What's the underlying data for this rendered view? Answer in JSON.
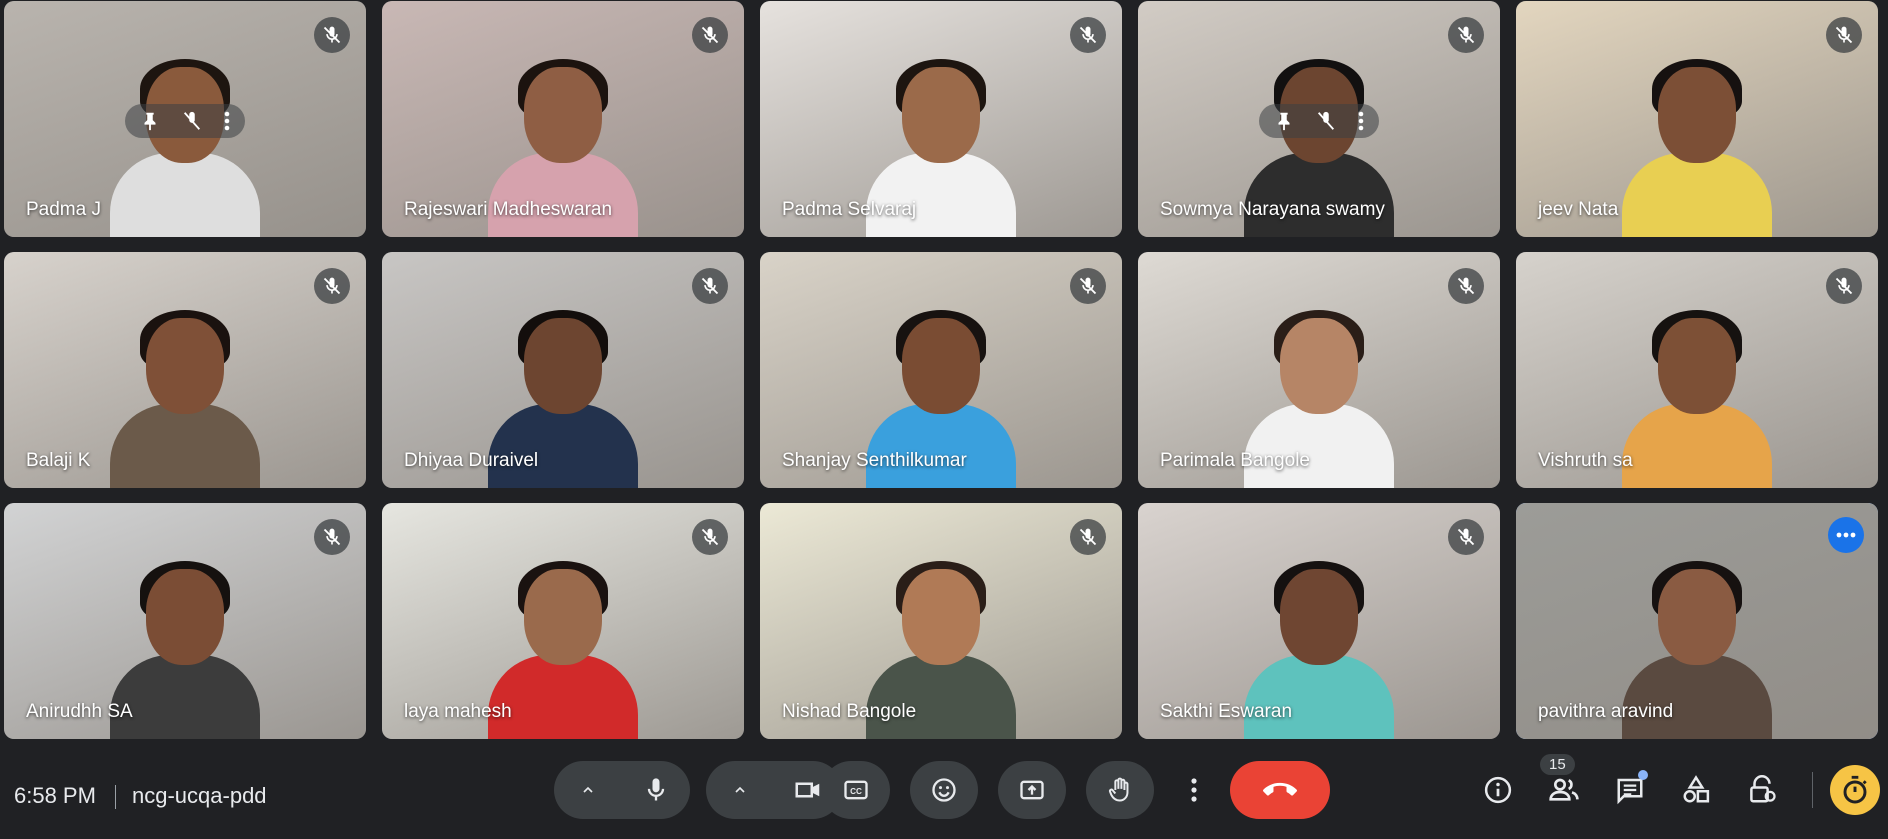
{
  "participants": [
    {
      "name": "Padma J",
      "muted": true,
      "bg": "#b9b4ae",
      "skin": "#8a5a3c",
      "shirt": "#dedede",
      "hair": "#1d1510",
      "pinned_controls": true
    },
    {
      "name": "Rajeswari Madheswaran",
      "muted": true,
      "bg": "#c9b8b5",
      "skin": "#8f5e44",
      "shirt": "#d6a2ad",
      "hair": "#1c130f"
    },
    {
      "name": "Padma Selvaraj",
      "muted": true,
      "bg": "#e6e2de",
      "skin": "#9b6a4a",
      "shirt": "#f2f2f2",
      "hair": "#1d1510"
    },
    {
      "name": "Sowmya Narayana swamy",
      "muted": true,
      "bg": "#d2ccc5",
      "skin": "#6c4530",
      "shirt": "#2d2d2d",
      "hair": "#121010",
      "pinned_controls": true
    },
    {
      "name": "jeev Nata",
      "muted": true,
      "bg": "#e3d6bf",
      "skin": "#7c4f36",
      "shirt": "#e8cf52",
      "hair": "#161110"
    },
    {
      "name": "Balaji K",
      "muted": true,
      "bg": "#d7d2cc",
      "skin": "#7f5037",
      "shirt": "#6b5a4a",
      "hair": "#1a120f"
    },
    {
      "name": "Dhiyaa Duraivel",
      "muted": true,
      "bg": "#c8c6c4",
      "skin": "#6d4530",
      "shirt": "#23324d",
      "hair": "#130e0c"
    },
    {
      "name": "Shanjay Senthilkumar",
      "muted": true,
      "bg": "#d9d3c8",
      "skin": "#7a4c33",
      "shirt": "#3aa0dd",
      "hair": "#171210"
    },
    {
      "name": "Parimala Bangole",
      "muted": true,
      "bg": "#dedad4",
      "skin": "#b68566",
      "shirt": "#f1f1f1",
      "hair": "#2a1e18"
    },
    {
      "name": "Vishruth sa",
      "muted": true,
      "bg": "#d6d2cc",
      "skin": "#7d5036",
      "shirt": "#e6a44a",
      "hair": "#161210"
    },
    {
      "name": "Anirudhh SA",
      "muted": true,
      "bg": "#d2d3d4",
      "skin": "#7b4d35",
      "shirt": "#3c3c3c",
      "hair": "#15110f"
    },
    {
      "name": "laya mahesh",
      "muted": true,
      "bg": "#e6e6e0",
      "skin": "#9a6a4c",
      "shirt": "#d12a2a",
      "hair": "#1a1210"
    },
    {
      "name": "Nishad Bangole",
      "muted": true,
      "bg": "#ece9d6",
      "skin": "#b07a56",
      "shirt": "#4a544a",
      "hair": "#2a1e18"
    },
    {
      "name": "Sakthi Eswaran",
      "muted": true,
      "bg": "#d9d3cf",
      "skin": "#6f4632",
      "shirt": "#5ec2bd",
      "hair": "#151110"
    },
    {
      "name": "pavithra aravind",
      "muted": false,
      "bg": "#9c9c98",
      "skin": "#8a5b42",
      "shirt": "#5a4a40",
      "hair": "#161110",
      "active": true
    }
  ],
  "meeting": {
    "time": "6:58 PM",
    "code": "ncg-ucqa-pdd"
  },
  "participant_count": "15",
  "icons": {
    "mic": "mic-icon",
    "camera": "camera-icon",
    "captions": "captions-icon",
    "emoji": "emoji-icon",
    "present": "present-icon",
    "hand": "raise-hand-icon",
    "more": "more-options-icon",
    "end": "end-call-icon",
    "info": "info-icon",
    "people": "people-icon",
    "chat": "chat-icon",
    "activities": "activities-icon",
    "host": "host-controls-icon",
    "timer": "timer-icon"
  },
  "colors": {
    "accent": "#8ab4f8",
    "end_call": "#ea4335",
    "control_bg": "#3c4043",
    "page_bg": "#202124"
  }
}
